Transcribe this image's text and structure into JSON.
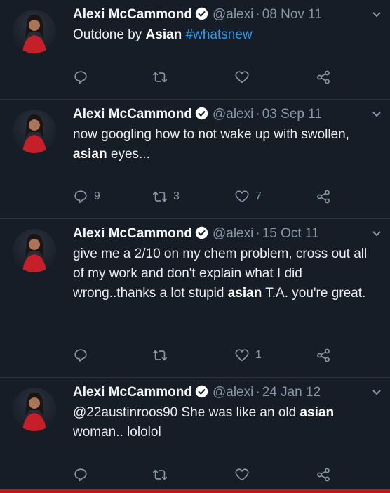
{
  "tweets": [
    {
      "name": "Alexi McCammond",
      "handle": "@alexi",
      "sep": "·",
      "date": "08 Nov 11",
      "parts": [
        {
          "t": "Outdone by "
        },
        {
          "t": "Asian",
          "b": true
        },
        {
          "t": " "
        },
        {
          "t": "#whatsnew",
          "h": true
        }
      ],
      "replies": "",
      "retweets": "",
      "likes": ""
    },
    {
      "name": "Alexi McCammond",
      "handle": "@alexi",
      "sep": "·",
      "date": "03 Sep 11",
      "parts": [
        {
          "t": "now googling how to not wake up with swollen, "
        },
        {
          "t": "asian",
          "b": true
        },
        {
          "t": " eyes..."
        }
      ],
      "replies": "9",
      "retweets": "3",
      "likes": "7"
    },
    {
      "name": "Alexi McCammond",
      "handle": "@alexi",
      "sep": "·",
      "date": "15 Oct 11",
      "parts": [
        {
          "t": "give me a 2/10 on my chem problem, cross out all of my work and don't explain what I did wrong..thanks a lot stupid "
        },
        {
          "t": "asian",
          "b": true
        },
        {
          "t": " T.A. you're great."
        }
      ],
      "replies": "",
      "retweets": "",
      "likes": "1"
    },
    {
      "name": "Alexi McCammond",
      "handle": "@alexi",
      "sep": "·",
      "date": "24 Jan 12",
      "parts": [
        {
          "t": "@22austinroos90 She was like an old "
        },
        {
          "t": "asian",
          "b": true
        },
        {
          "t": " woman.. lololol"
        }
      ],
      "replies": "",
      "retweets": "",
      "likes": ""
    }
  ],
  "icons": {
    "reply": "reply-icon",
    "retweet": "retweet-icon",
    "like": "heart-icon",
    "share": "share-icon",
    "verified": "verified-badge-icon",
    "menu": "chevron-down-icon"
  },
  "colors": {
    "background": "#161d27",
    "text": "#e9eef3",
    "muted": "#8a98a6",
    "hashtag": "#2f9be8",
    "verified": "#ffffff",
    "bottom_line": "#c3161c"
  }
}
